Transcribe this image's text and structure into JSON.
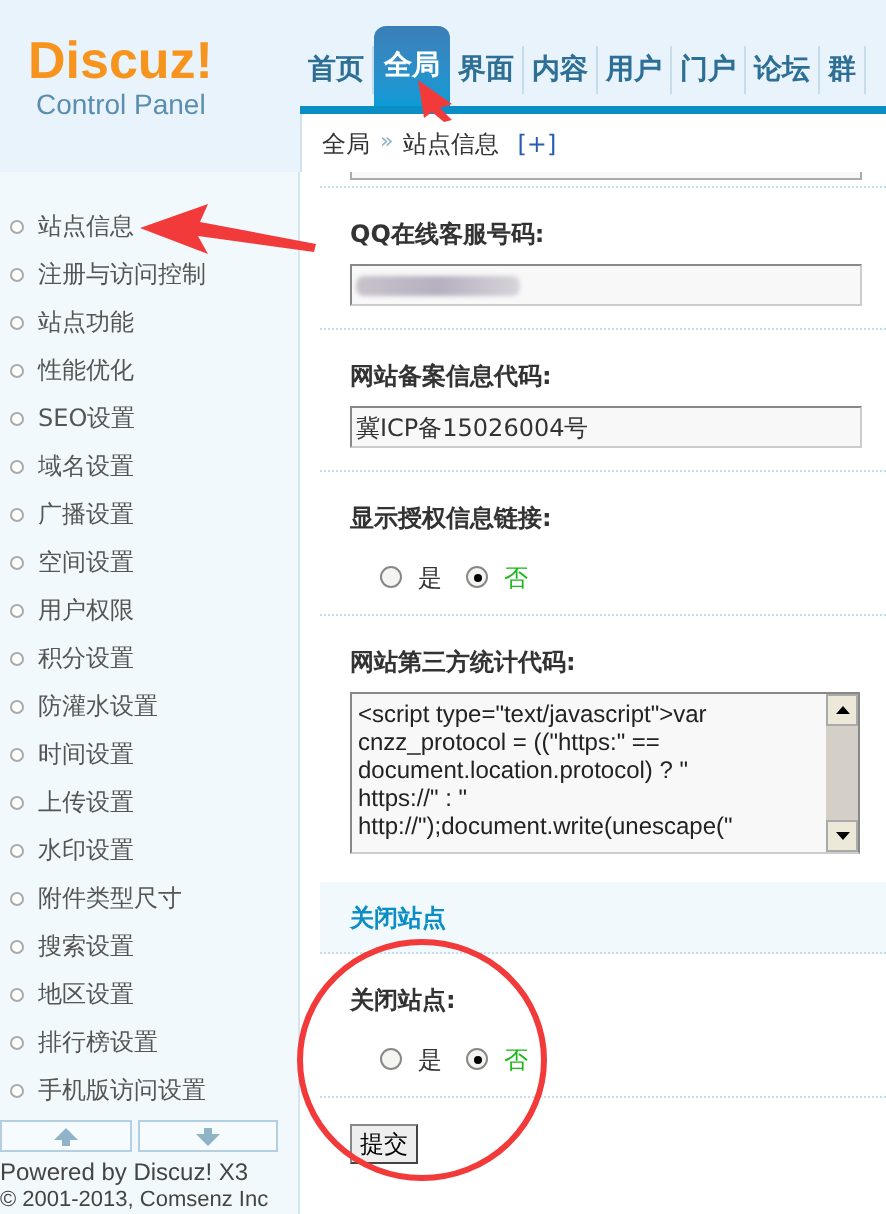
{
  "logo": {
    "name": "Discuz!",
    "subtitle": "Control Panel"
  },
  "nav_tabs": [
    {
      "label": "首页",
      "selected": false
    },
    {
      "label": "全局",
      "selected": true
    },
    {
      "label": "界面",
      "selected": false
    },
    {
      "label": "内容",
      "selected": false
    },
    {
      "label": "用户",
      "selected": false
    },
    {
      "label": "门户",
      "selected": false
    },
    {
      "label": "论坛",
      "selected": false
    },
    {
      "label": "群",
      "selected": false
    }
  ],
  "breadcrumb": {
    "items": [
      "全局",
      "站点信息"
    ],
    "separator": "»",
    "add": "[+]"
  },
  "sidebar": {
    "items": [
      "站点信息",
      "注册与访问控制",
      "站点功能",
      "性能优化",
      "SEO设置",
      "域名设置",
      "广播设置",
      "空间设置",
      "用户权限",
      "积分设置",
      "防灌水设置",
      "时间设置",
      "上传设置",
      "水印设置",
      "附件类型尺寸",
      "搜索设置",
      "地区设置",
      "排行榜设置",
      "手机版访问设置"
    ]
  },
  "footer": {
    "powered": "Powered by Discuz! X3",
    "copyright": "© 2001-2013, Comsenz Inc"
  },
  "form": [
    {
      "kind": "field",
      "label": "QQ在线客服号码:",
      "blurred": true
    },
    {
      "kind": "field",
      "label": "网站备案信息代码:",
      "value": "冀ICP备15026004号",
      "blurred": false
    },
    {
      "kind": "radio",
      "label": "显示授权信息链接:",
      "options": [
        {
          "label": "是",
          "selected": false
        },
        {
          "label": "否",
          "selected": true
        }
      ]
    },
    {
      "kind": "textarea",
      "label": "网站第三方统计代码:",
      "lines": [
        "<script type=\"text/javascript\">var",
        "cnzz_protocol = ((\"https:\" ==",
        "document.location.protocol) ? \"",
        "https://\" : \"",
        "http://\");document.write(unescape(\""
      ]
    },
    {
      "kind": "section",
      "label": "关闭站点"
    },
    {
      "kind": "radio",
      "label": "关闭站点:",
      "options": [
        {
          "label": "是",
          "selected": false
        },
        {
          "label": "否",
          "selected": true
        }
      ]
    }
  ],
  "submit": "提交"
}
